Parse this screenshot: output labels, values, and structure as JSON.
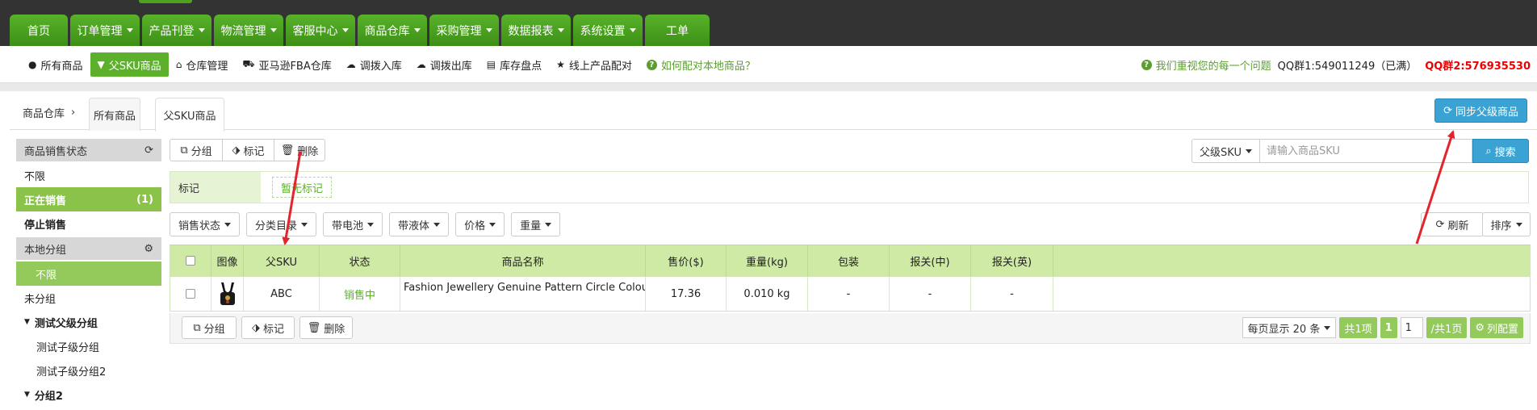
{
  "main_nav": [
    {
      "label": "首页",
      "dropdown": false
    },
    {
      "label": "订单管理",
      "dropdown": true
    },
    {
      "label": "产品刊登",
      "dropdown": true
    },
    {
      "label": "物流管理",
      "dropdown": true
    },
    {
      "label": "客服中心",
      "dropdown": true
    },
    {
      "label": "商品仓库",
      "dropdown": true
    },
    {
      "label": "采购管理",
      "dropdown": true
    },
    {
      "label": "数据报表",
      "dropdown": true
    },
    {
      "label": "系统设置",
      "dropdown": true
    },
    {
      "label": "工单",
      "dropdown": false
    }
  ],
  "sub_nav": {
    "items": [
      {
        "label": "所有商品",
        "icon": "circle-icon"
      },
      {
        "label": "父SKU商品",
        "icon": "filter-icon",
        "active": true
      },
      {
        "label": "仓库管理",
        "icon": "home-icon"
      },
      {
        "label": "亚马逊FBA仓库",
        "icon": "truck-icon"
      },
      {
        "label": "调拨入库",
        "icon": "cloud-upload-icon"
      },
      {
        "label": "调拨出库",
        "icon": "cloud-download-icon"
      },
      {
        "label": "库存盘点",
        "icon": "hdd-icon"
      },
      {
        "label": "线上产品配对",
        "icon": "star-icon"
      },
      {
        "label": "如何配对本地商品？",
        "icon": "question-icon",
        "help": true
      }
    ],
    "right_help": "我们重视您的每一个问题",
    "qq1": "QQ群1:549011249（已满）",
    "qq2": "QQ群2:576935530"
  },
  "breadcrumb": {
    "root": "商品仓库",
    "tabs": [
      "所有商品",
      "父SKU商品"
    ],
    "active_tab": "父SKU商品"
  },
  "sync_button": "同步父级商品",
  "sidebar": {
    "sale_status": {
      "title": "商品销售状态",
      "items": [
        {
          "label": "不限"
        },
        {
          "label": "正在销售",
          "count": "(1)",
          "active": true
        },
        {
          "label": "停止销售"
        }
      ]
    },
    "local_group": {
      "title": "本地分组",
      "items": [
        {
          "label": "不限",
          "active": true
        },
        {
          "label": "未分组"
        },
        {
          "label": "测试父级分组",
          "expandable": true
        },
        {
          "label": "测试子级分组",
          "child": true
        },
        {
          "label": "测试子级分组2",
          "child": true
        },
        {
          "label": "分组2",
          "expandable": true
        }
      ]
    }
  },
  "toolbar": {
    "group": "分组",
    "mark": "标记",
    "delete": "删除"
  },
  "search": {
    "field_select": "父级SKU",
    "placeholder": "请输入商品SKU",
    "button": "搜索"
  },
  "tag_row": {
    "label": "标记",
    "empty": "暂无标记"
  },
  "filters": [
    "销售状态",
    "分类目录",
    "带电池",
    "带液体",
    "价格",
    "重量"
  ],
  "refresh": "刷新",
  "sort": "排序",
  "table": {
    "headers": [
      "",
      "图像",
      "父SKU",
      "状态",
      "商品名称",
      "售价($)",
      "重量(kg)",
      "包装",
      "报关(中)",
      "报关(英)",
      ""
    ],
    "rows": [
      {
        "sku": "ABC",
        "status": "销售中",
        "name": "Fashion Jewellery Genuine Pattern Circle Colour",
        "price": "17.36",
        "weight": "0.010 kg",
        "package": "-",
        "customs_cn": "-",
        "customs_en": "-"
      }
    ]
  },
  "pagination": {
    "per_page": "每页显示 20 条",
    "total": "共1项",
    "current": "1",
    "page_input": "1",
    "total_pages": "/共1页",
    "columns_config": "列配置"
  }
}
